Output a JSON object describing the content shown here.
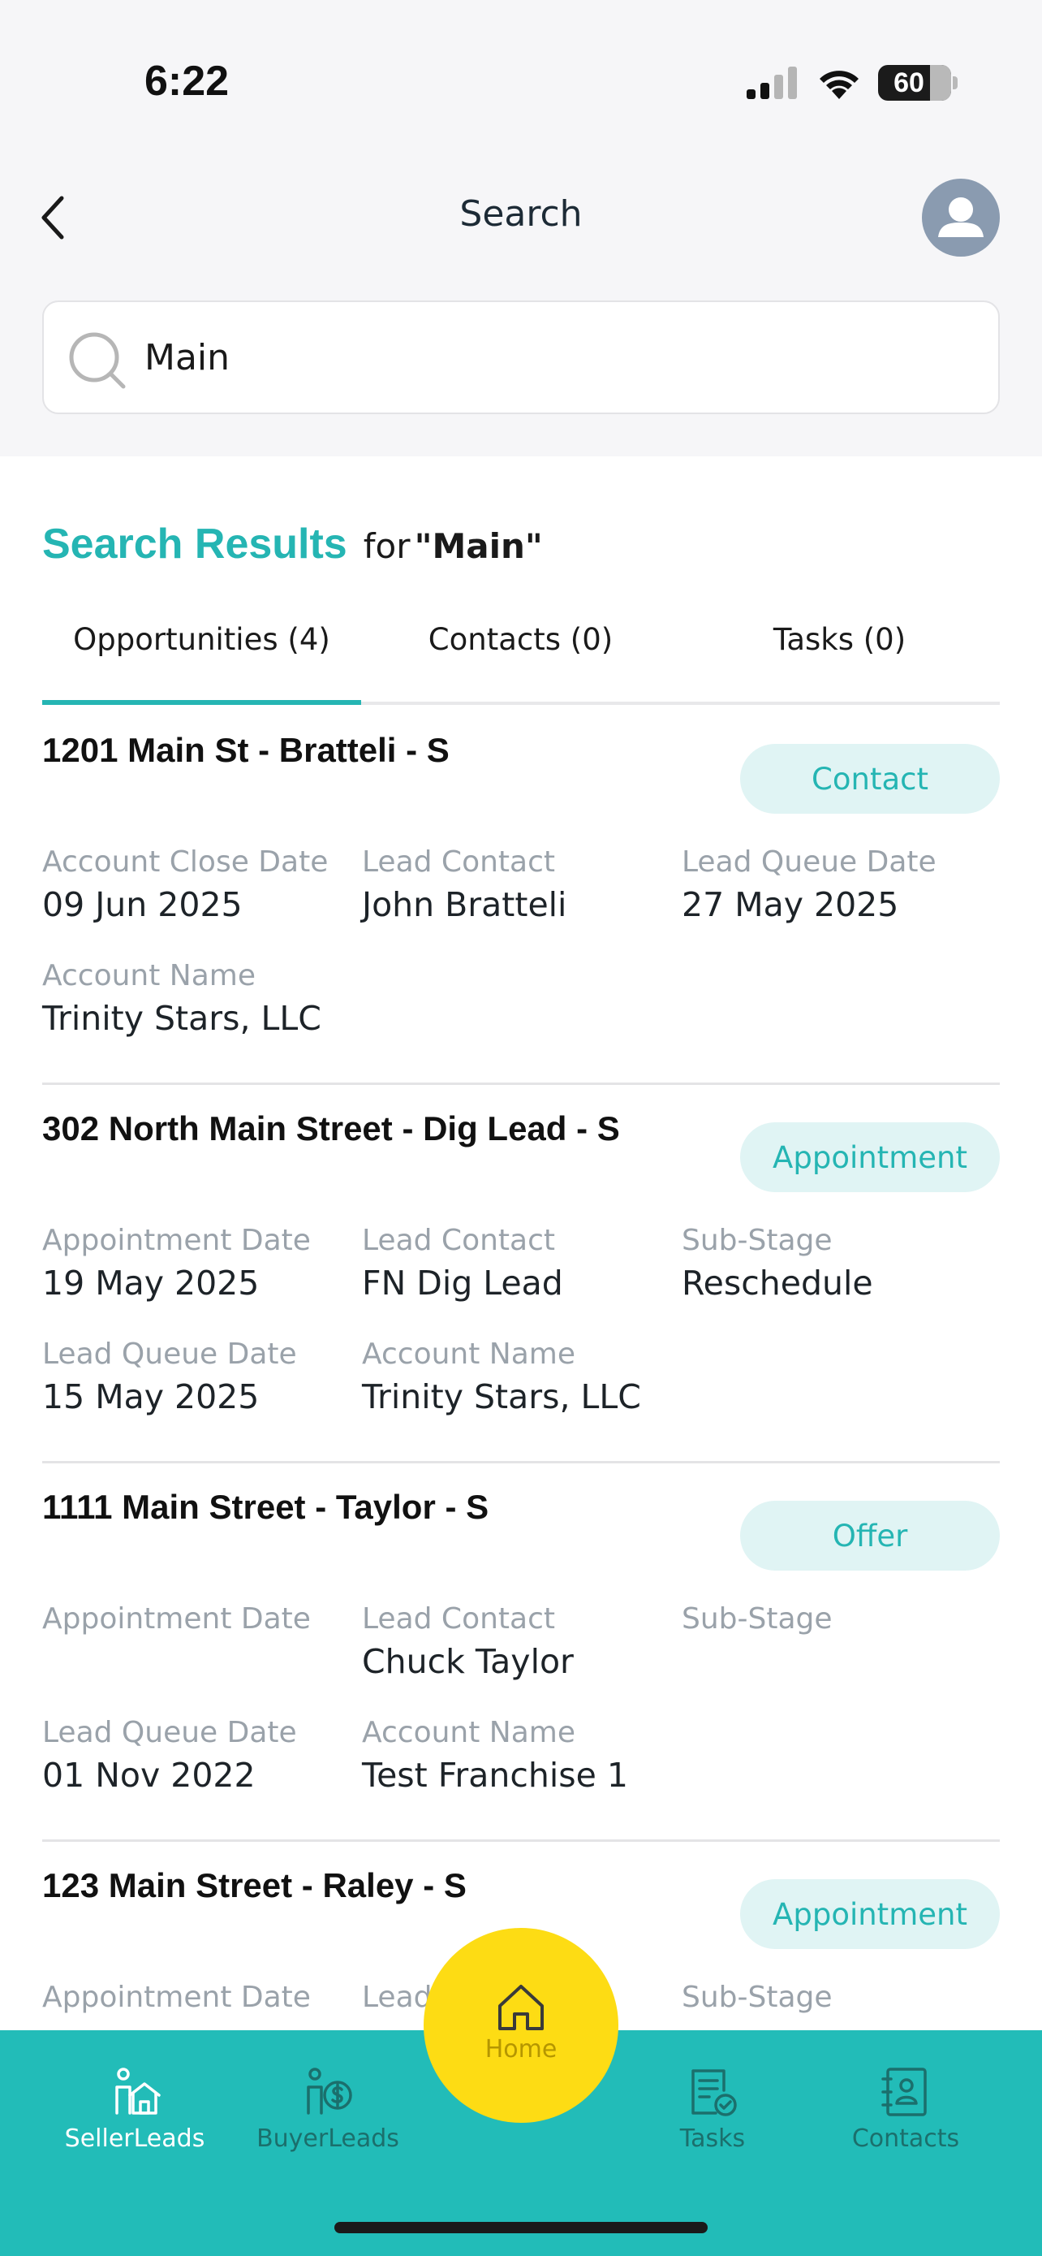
{
  "status_bar": {
    "time": "6:22",
    "battery": "60"
  },
  "header": {
    "title": "Search"
  },
  "search": {
    "value": "Main",
    "placeholder": ""
  },
  "results": {
    "title": "Search Results",
    "for_label": "for",
    "query": "\"Main\""
  },
  "tabs": [
    {
      "label": "Opportunities (4)",
      "active": true
    },
    {
      "label": "Contacts (0)",
      "active": false
    },
    {
      "label": "Tasks (0)",
      "active": false
    }
  ],
  "opportunities": [
    {
      "title": "1201 Main St - Bratteli - S",
      "stage": "Contact",
      "fields": [
        {
          "label": "Account Close Date",
          "value": "09 Jun 2025"
        },
        {
          "label": "Lead Contact",
          "value": "John Bratteli"
        },
        {
          "label": "Lead Queue Date",
          "value": "27 May 2025"
        },
        {
          "label": "Account Name",
          "value": "Trinity Stars, LLC"
        }
      ]
    },
    {
      "title": "302 North Main Street - Dig Lead - S",
      "stage": "Appointment",
      "fields": [
        {
          "label": "Appointment Date",
          "value": "19 May 2025"
        },
        {
          "label": "Lead Contact",
          "value": "FN Dig Lead"
        },
        {
          "label": "Sub-Stage",
          "value": "Reschedule"
        },
        {
          "label": "Lead Queue Date",
          "value": "15 May 2025"
        },
        {
          "label": "Account Name",
          "value": "Trinity Stars, LLC"
        }
      ]
    },
    {
      "title": "1111 Main Street - Taylor - S",
      "stage": "Offer",
      "fields": [
        {
          "label": "Appointment Date",
          "value": ""
        },
        {
          "label": "Lead Contact",
          "value": "Chuck Taylor"
        },
        {
          "label": "Sub-Stage",
          "value": ""
        },
        {
          "label": "Lead Queue Date",
          "value": "01 Nov 2022"
        },
        {
          "label": "Account Name",
          "value": "Test Franchise 1"
        }
      ]
    },
    {
      "title": "123 Main Street - Raley - S",
      "stage": "Appointment",
      "fields": [
        {
          "label": "Appointment Date",
          "value": ""
        },
        {
          "label": "Lead",
          "value": ""
        },
        {
          "label": "Sub-Stage",
          "value": ""
        }
      ]
    }
  ],
  "bottom_nav": {
    "seller_leads": "SellerLeads",
    "buyer_leads": "BuyerLeads",
    "home": "Home",
    "tasks": "Tasks",
    "contacts": "Contacts"
  },
  "colors": {
    "accent": "#25b5b3",
    "nav_bg": "#22bcb8",
    "home_button": "#fddc14",
    "pill_bg": "#e0f4f4"
  }
}
